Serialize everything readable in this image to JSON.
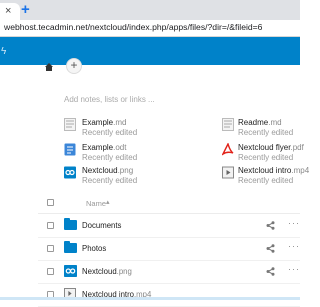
{
  "browser": {
    "tab_close": "×",
    "new_tab": "+",
    "url": "webhost.tecadmin.net/nextcloud/index.php/apps/files/?dir=/&fileid=6"
  },
  "header": {
    "accent": "#0082c9",
    "apps_icon": "bolt-icon"
  },
  "toolbar": {
    "add_label": "+"
  },
  "notes_placeholder": "Add notes, lists or links ...",
  "recent": [
    {
      "base": "Example",
      "ext": ".md",
      "sub": "Recently edited",
      "icon": "text-file-icon"
    },
    {
      "base": "Readme",
      "ext": ".md",
      "sub": "Recently edited",
      "icon": "text-file-icon"
    },
    {
      "base": "Example",
      "ext": ".odt",
      "sub": "Recently edited",
      "icon": "document-icon"
    },
    {
      "base": "Nextcloud flyer",
      "ext": ".pdf",
      "sub": "Recently edited",
      "icon": "pdf-icon"
    },
    {
      "base": "Nextcloud",
      "ext": ".png",
      "sub": "Recently edited",
      "icon": "image-icon"
    },
    {
      "base": "Nextcloud intro",
      "ext": ".mp4",
      "sub": "Recently edited",
      "icon": "video-icon"
    }
  ],
  "table": {
    "name_header": "Name",
    "sort_indicator": "▴",
    "rows": [
      {
        "base": "Documents",
        "ext": "",
        "type": "folder"
      },
      {
        "base": "Photos",
        "ext": "",
        "type": "folder"
      },
      {
        "base": "Nextcloud",
        "ext": ".png",
        "type": "image"
      },
      {
        "base": "Nextcloud intro",
        "ext": ".mp4",
        "type": "video"
      }
    ],
    "more": "···"
  }
}
